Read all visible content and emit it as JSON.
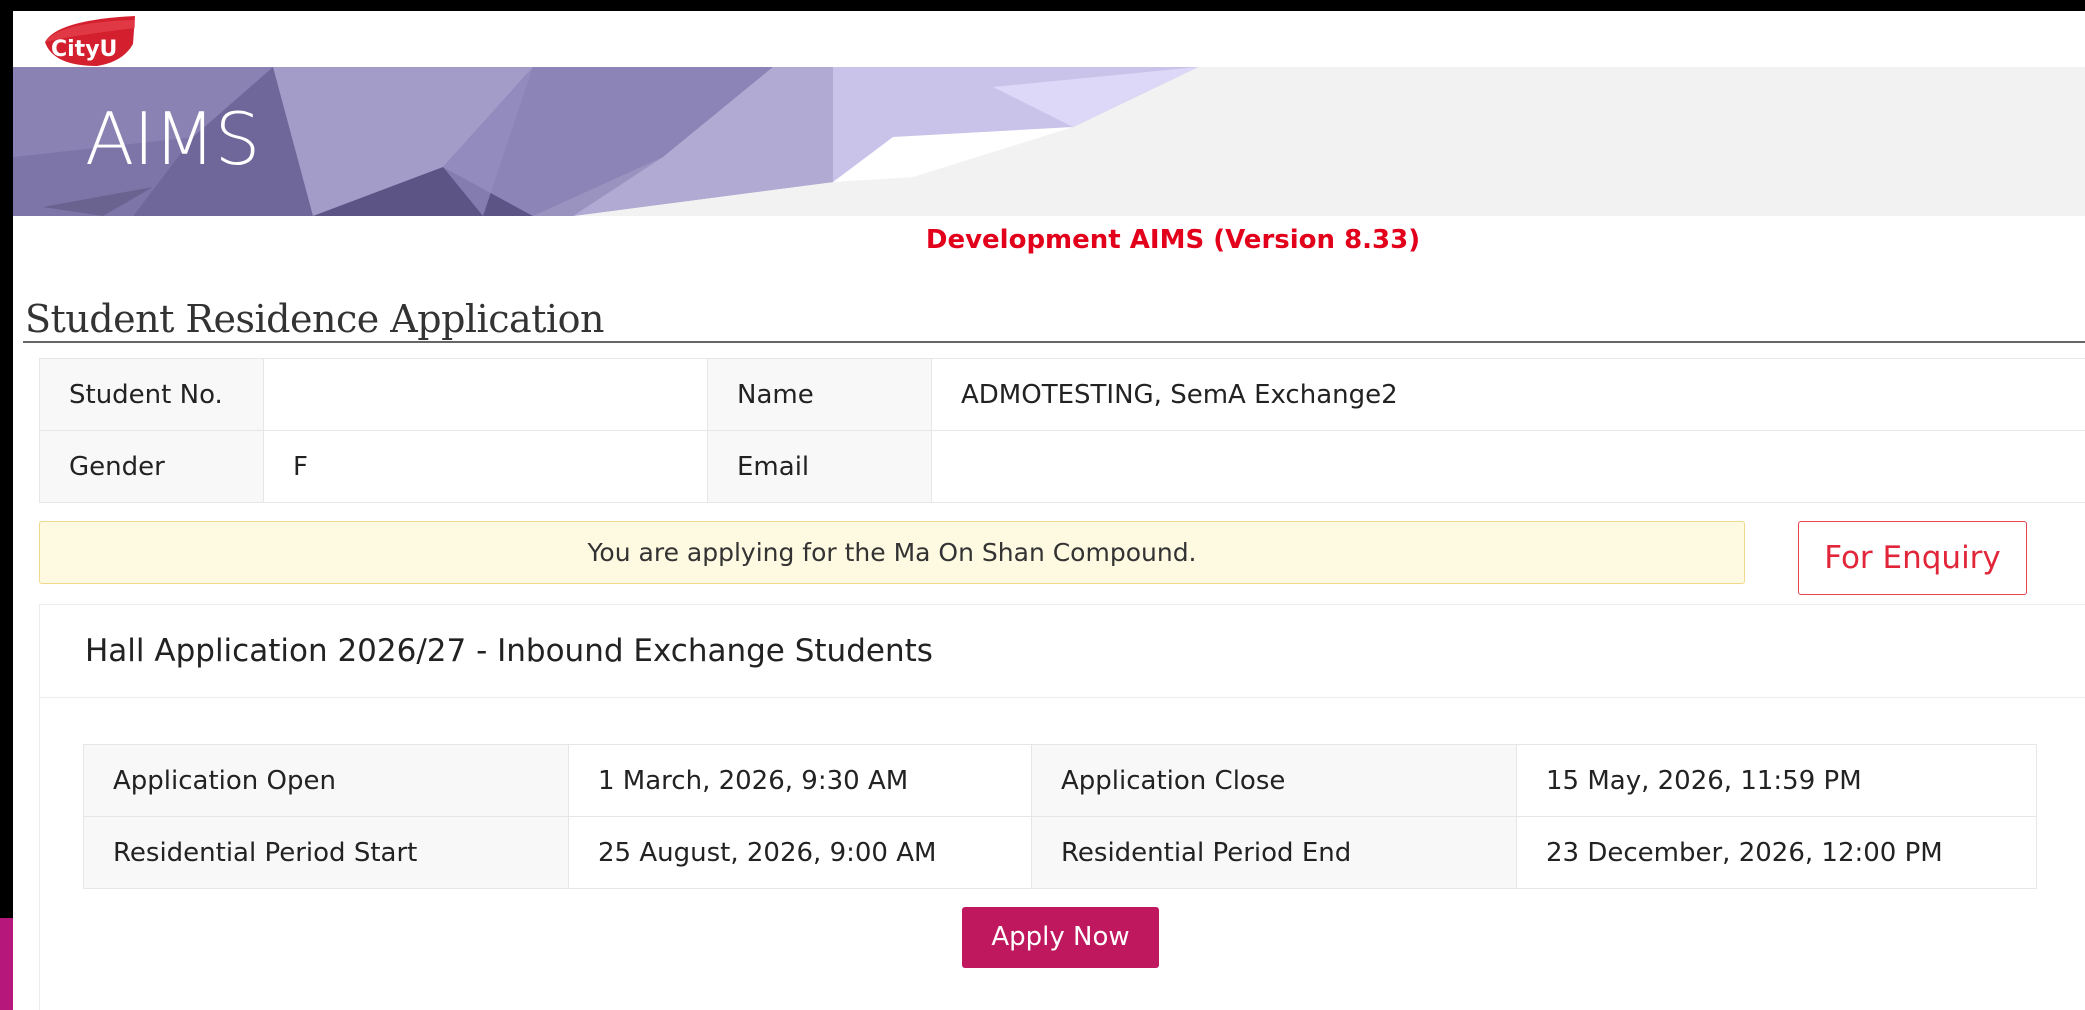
{
  "brand": {
    "logo_text": "CityU",
    "banner_title": "AIMS",
    "colors": {
      "accent": "#c0185e",
      "notice_red": "#e2001a",
      "banner_purple": "#8f86b8"
    }
  },
  "dev_notice": "Development AIMS (Version 8.33)",
  "page_title": "Student Residence Application",
  "student": {
    "student_no_label": "Student No.",
    "student_no_value": "",
    "name_label": "Name",
    "name_value": "ADMOTESTING, SemA Exchange2",
    "gender_label": "Gender",
    "gender_value": "F",
    "email_label": "Email",
    "email_value": ""
  },
  "notice": "You are applying for the Ma On Shan Compound.",
  "enquiry_button": "For Enquiry",
  "application": {
    "heading": "Hall Application 2026/27 - Inbound Exchange Students",
    "open_label": "Application Open",
    "open_value": "1 March, 2026, 9:30 AM",
    "close_label": "Application Close",
    "close_value": "15 May, 2026, 11:59 PM",
    "res_start_label": "Residential Period Start",
    "res_start_value": "25 August, 2026, 9:00 AM",
    "res_end_label": "Residential Period End",
    "res_end_value": "23 December, 2026, 12:00 PM",
    "apply_button": "Apply Now"
  }
}
